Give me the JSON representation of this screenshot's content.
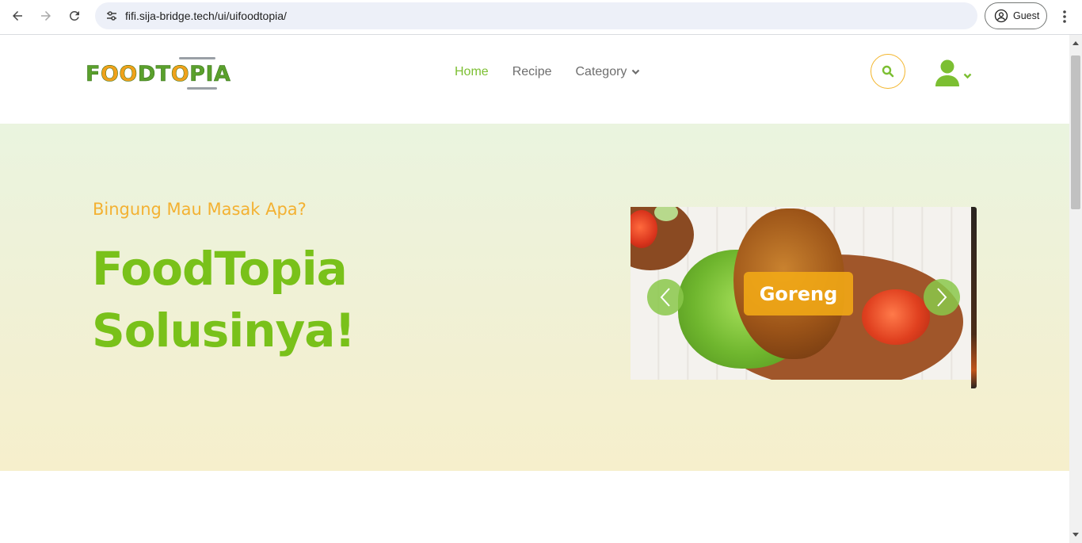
{
  "browser": {
    "url": "fifi.sija-bridge.tech/ui/uifoodtopia/",
    "profile_label": "Guest"
  },
  "header": {
    "logo_text": "FOODTOPIA",
    "nav": [
      {
        "label": "Home",
        "active": true
      },
      {
        "label": "Recipe",
        "active": false
      },
      {
        "label": "Category",
        "active": false,
        "has_dropdown": true
      }
    ],
    "icons": [
      "search-icon",
      "user-icon",
      "chevron-down-icon"
    ]
  },
  "hero": {
    "tagline": "Bingung Mau Masak Apa?",
    "headline_line1": "FoodTopia",
    "headline_line2": "Solusinya!",
    "carousel": {
      "caption": "Goreng",
      "icons": [
        "chevron-left-icon",
        "chevron-right-icon"
      ]
    }
  },
  "colors": {
    "accent_green": "#7cbf32",
    "headline_green": "#79c11a",
    "accent_orange": "#f3b132",
    "nav_gray": "#6e6e6e"
  }
}
